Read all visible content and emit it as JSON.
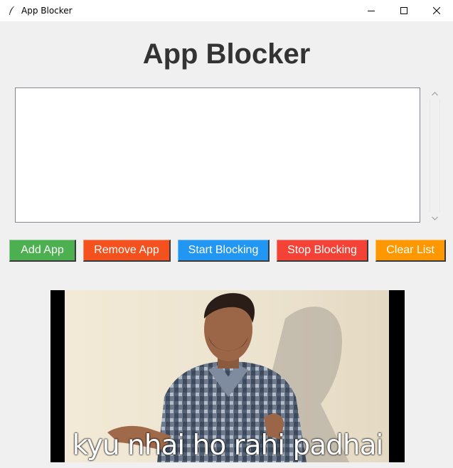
{
  "window": {
    "title": "App Blocker",
    "icon": "feather-icon"
  },
  "heading": "App Blocker",
  "app_list": {
    "items": []
  },
  "buttons": {
    "add": {
      "label": "Add App",
      "color": "#4caf50"
    },
    "remove": {
      "label": "Remove App",
      "color": "#f4511e"
    },
    "start": {
      "label": "Start Blocking",
      "color": "#2196f3"
    },
    "stop": {
      "label": "Stop Blocking",
      "color": "#f44336"
    },
    "clear": {
      "label": "Clear List",
      "color": "#ff9800"
    }
  },
  "meme": {
    "caption": "kyu nhai ho rahi padhai"
  }
}
